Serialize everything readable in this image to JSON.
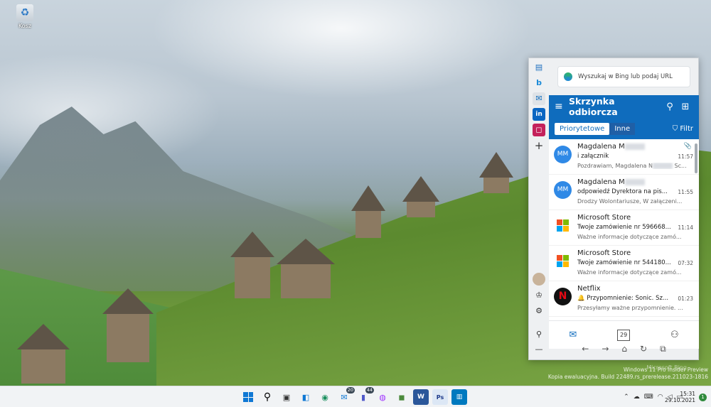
{
  "desktop": {
    "recycle_bin_label": "Kosz",
    "watermark_brand": "Microsoft Bing",
    "watermark_lines": [
      "Windows 11 Pro Insider Preview",
      "Kopia ewaluacyjna. Build 22489.rs_prerelease.211023-1816"
    ]
  },
  "sidebar": {
    "search_placeholder": "Wyszukaj w Bing lub podaj URL",
    "rail_icons": [
      "tools-icon",
      "bing-icon",
      "outlook-icon",
      "linkedin-icon",
      "office-icon",
      "add-icon"
    ],
    "rail_bottom_icons": [
      "profile-icon",
      "games-icon",
      "settings-icon",
      "pin-icon",
      "minimize-icon"
    ]
  },
  "mail": {
    "title": "Skrzynka odbiorcza",
    "tab_focused": "Priorytetowe",
    "tab_other": "Inne",
    "filter_label": "Filtr",
    "items": [
      {
        "sender": "Magdalena M",
        "subject": "i załącznik",
        "preview": "Pozdrawiam, Magdalena N",
        "preview_tail": "Sc...",
        "time": "11:57",
        "avatar": "MM",
        "kind": "person",
        "attachment": true
      },
      {
        "sender": "Magdalena M",
        "subject": "odpowiedź Dyrektora na pis...",
        "preview": "Drodzy Wolontariusze, W załączeni...",
        "preview_tail": "",
        "time": "11:55",
        "avatar": "MM",
        "kind": "person",
        "attachment": false
      },
      {
        "sender": "Microsoft Store",
        "subject": "Twoje zamówienie nr 596668...",
        "preview": "Ważne informacje dotyczące zamó...",
        "preview_tail": "",
        "time": "11:14",
        "avatar": "",
        "kind": "ms",
        "attachment": false
      },
      {
        "sender": "Microsoft Store",
        "subject": "Twoje zamówienie nr 544180...",
        "preview": "Ważne informacje dotyczące zamó...",
        "preview_tail": "",
        "time": "07:32",
        "avatar": "",
        "kind": "ms",
        "attachment": false
      },
      {
        "sender": "Netflix",
        "subject": "🔔 Przypomnienie: Sonic. Sz...",
        "preview": "Przesyłamy ważne przypomnienie. ...",
        "preview_tail": "",
        "time": "01:23",
        "avatar": "N",
        "kind": "netflix",
        "attachment": false
      }
    ],
    "footer_calendar_day": "29"
  },
  "taskbar": {
    "badges": {
      "mail": "20",
      "teams": "44"
    },
    "time": "15:31",
    "date": "29.10.2021",
    "notification_count": "1",
    "colors": {
      "accent": "#0f78d4",
      "outlook_blue": "#0f6cbd"
    }
  }
}
